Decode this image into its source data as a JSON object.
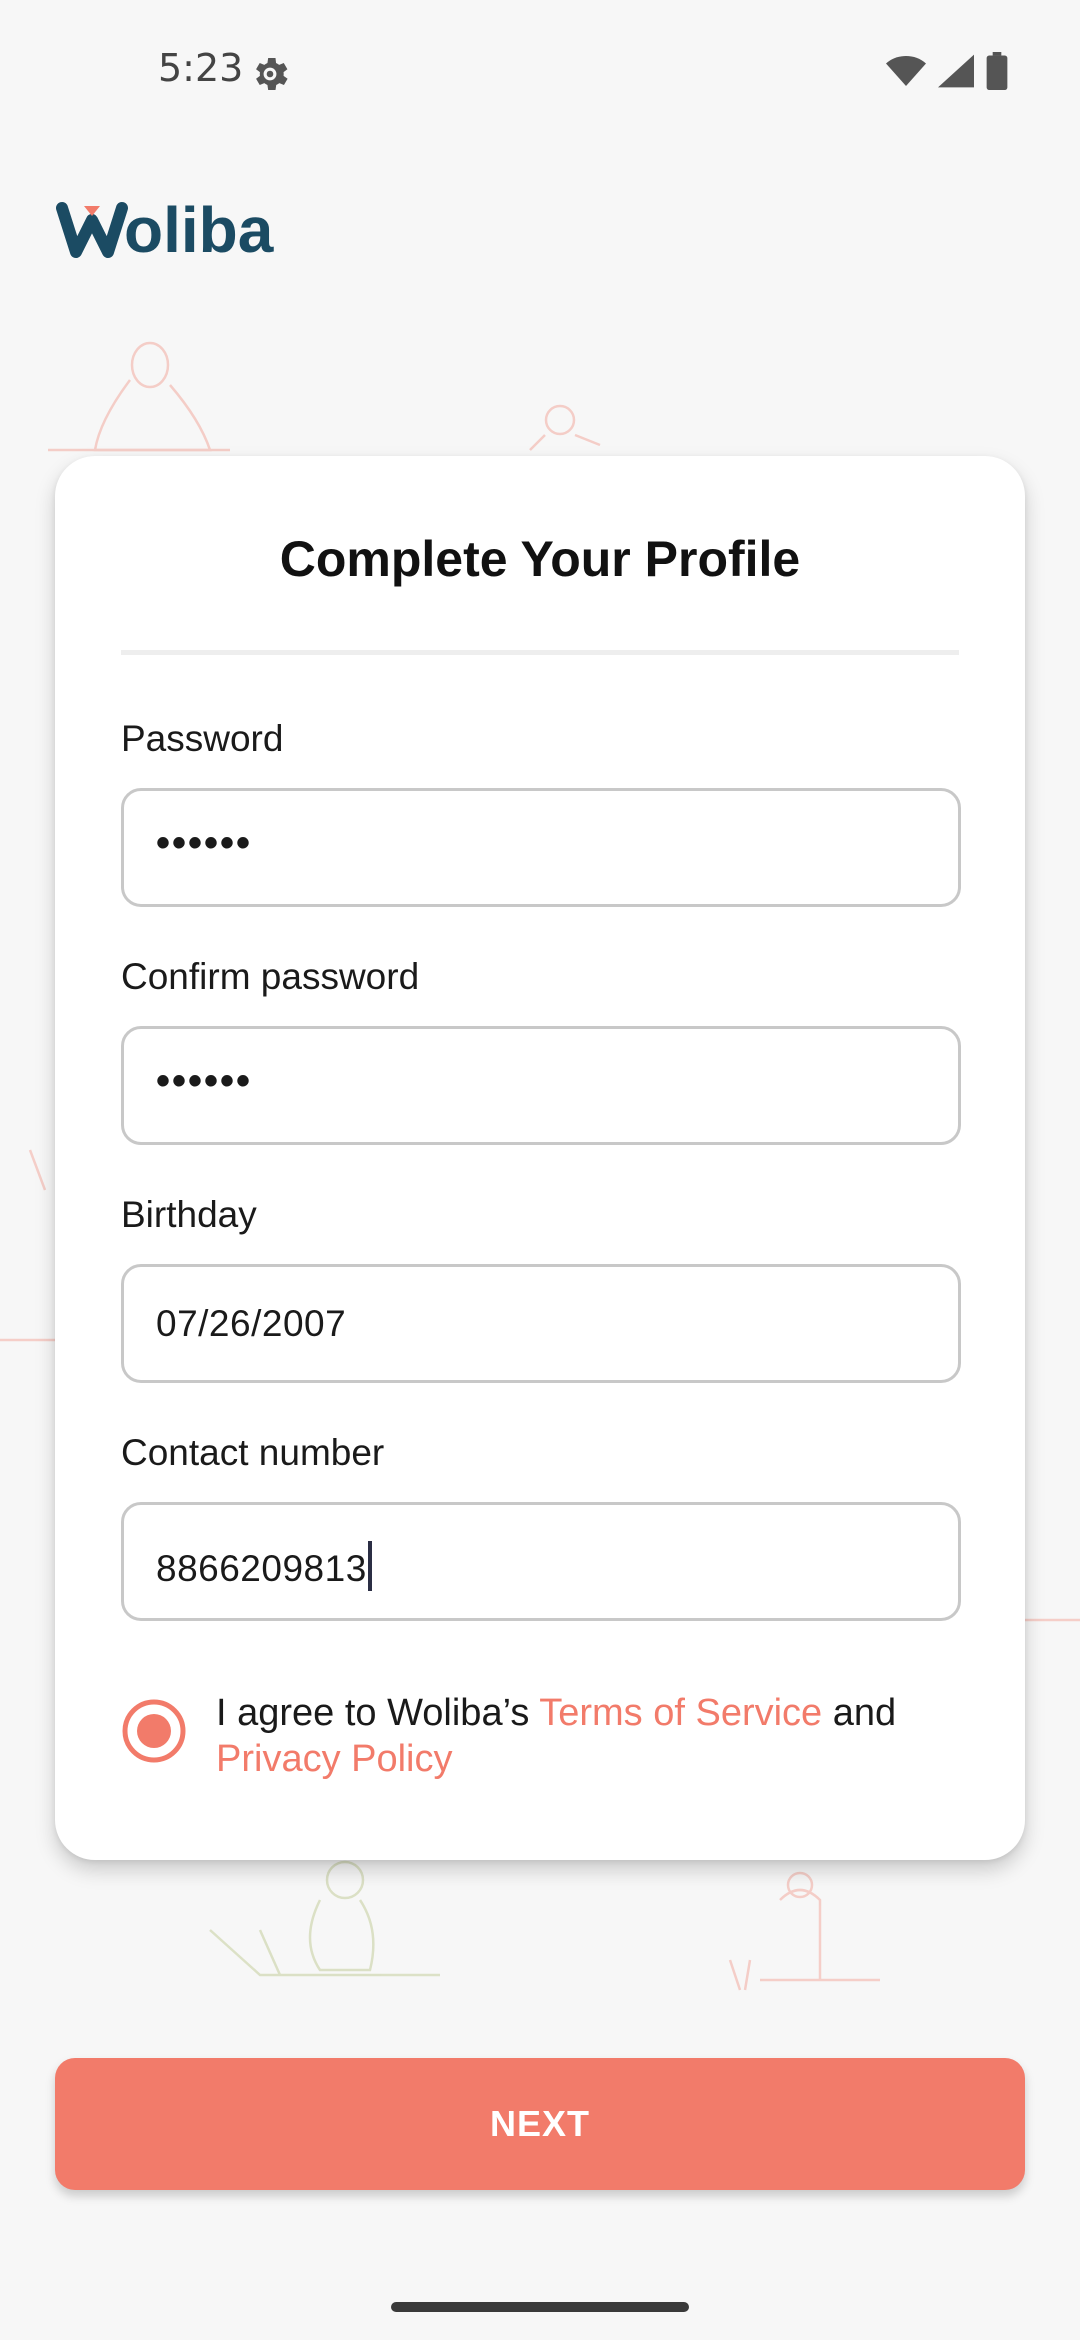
{
  "status_bar": {
    "time": "5:23",
    "icons": [
      "gear-icon",
      "wifi-icon",
      "cellular-icon",
      "battery-icon"
    ]
  },
  "brand": {
    "logo_text": "Woliba",
    "primary_color": "#1b4b63",
    "accent_color": "#f27b6a"
  },
  "form": {
    "title": "Complete Your Profile",
    "fields": [
      {
        "label": "Password",
        "value": "••••••",
        "type": "password"
      },
      {
        "label": "Confirm password",
        "value": "••••••",
        "type": "password"
      },
      {
        "label": "Birthday",
        "value": "07/26/2007",
        "type": "date"
      },
      {
        "label": "Contact number",
        "value": "8866209813",
        "type": "tel"
      }
    ],
    "agreement": {
      "prefix": "I agree to Woliba’s ",
      "terms_link": "Terms of Service",
      "middle": " and ",
      "privacy_link": "Privacy Policy",
      "checked": true
    }
  },
  "actions": {
    "next_label": "NEXT"
  }
}
